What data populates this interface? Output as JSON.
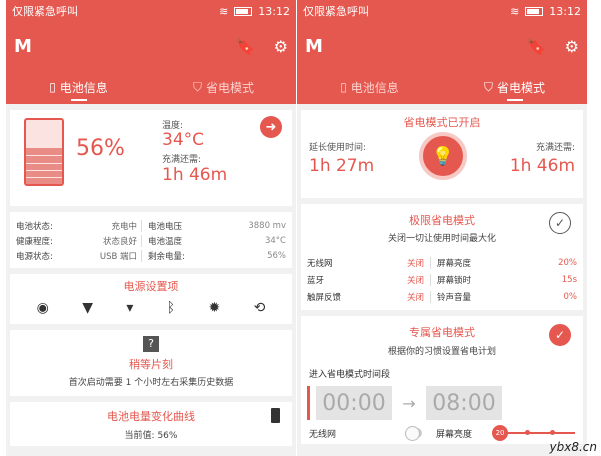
{
  "status": {
    "carrier": "仅限紧急呼叫",
    "time": "13:12"
  },
  "app": {
    "logo": "M",
    "tabs": [
      "电池信息",
      "省电模式"
    ]
  },
  "s1": {
    "battery_pct": "56%",
    "battery_level": 0.56,
    "temp_label": "温度:",
    "temp_value": "34°C",
    "charge_label": "充满还需:",
    "charge_value": "1h 46m",
    "info": [
      {
        "k": "电池状态:",
        "v": "充电中",
        "k2": "电池电压",
        "v2": "3880 mv"
      },
      {
        "k": "健康程度:",
        "v": "状态良好",
        "k2": "电池温度",
        "v2": "34°C"
      },
      {
        "k": "电源状态:",
        "v": "USB 端口",
        "k2": "剩余电量:",
        "v2": "56%"
      }
    ],
    "settings_title": "电源设置项",
    "wait_title": "稍等片刻",
    "wait_sub": "首次启动需要 1 个小时左右采集历史数据",
    "wait_icon": "?",
    "curve_title": "电池电量变化曲线",
    "curve_sub": "当前值: 56%"
  },
  "s2": {
    "header": "省电模式已开启",
    "extend_label": "延长使用时间:",
    "extend_value": "1h 27m",
    "charge_label": "充满还需:",
    "charge_value": "1h 46m",
    "extreme_title": "极限省电模式",
    "extreme_sub": "关闭一切让使用时间最大化",
    "grid": [
      {
        "k": "无线网",
        "v": "关闭",
        "k2": "屏幕亮度",
        "v2": "20%"
      },
      {
        "k": "蓝牙",
        "v": "关闭",
        "k2": "屏幕锁时",
        "v2": "15s"
      },
      {
        "k": "触屏反馈",
        "v": "关闭",
        "k2": "铃声音量",
        "v2": "0%"
      }
    ],
    "own_title": "专属省电模式",
    "own_sub": "根据你的习惯设置省电计划",
    "period_label": "进入省电模式时间段",
    "start_time": "00:00",
    "end_time": "08:00",
    "wifi_label": "无线网",
    "brightness_label": "屏幕亮度",
    "brightness_value": "20"
  },
  "watermark": "ybx8.cn"
}
